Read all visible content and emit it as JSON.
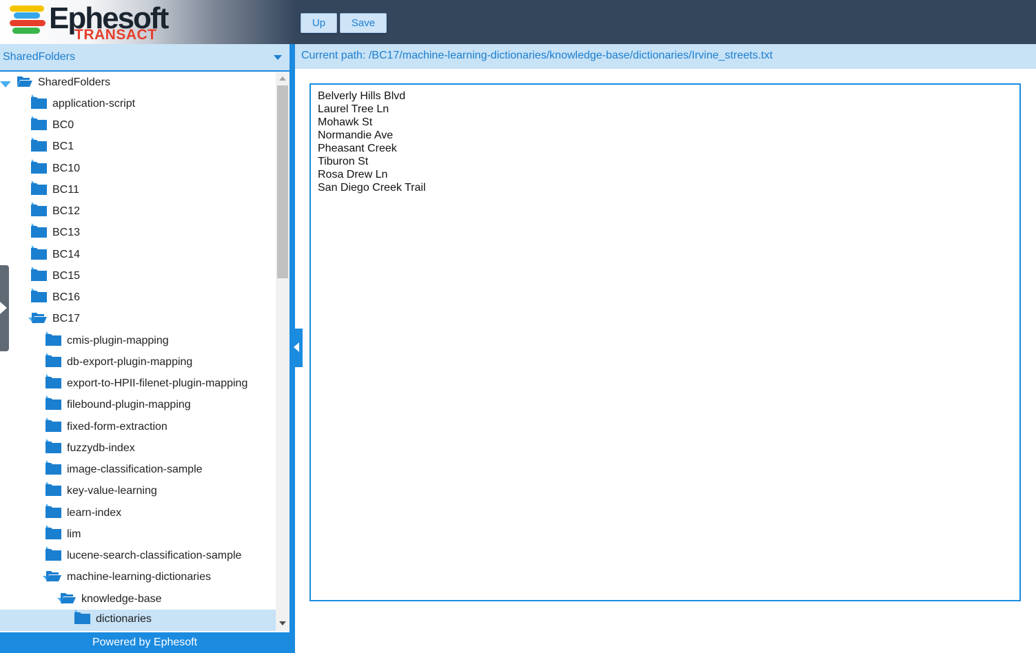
{
  "header": {
    "logo_text": "Ephesoft",
    "logo_subtext": "TRANSACT",
    "buttons": {
      "up_label": "Up",
      "save_label": "Save"
    },
    "colors": {
      "header_bg": "#34465c",
      "accent": "#1b8be0",
      "logo_red": "#e53f2c"
    }
  },
  "sidebar": {
    "dropdown_value": "SharedFolders",
    "footer": "Powered by Ephesoft",
    "tree": [
      {
        "label": "SharedFolders",
        "level": 0,
        "expanded": true,
        "selected": false
      },
      {
        "label": "application-script",
        "level": 1,
        "expanded": false,
        "selected": false
      },
      {
        "label": "BC0",
        "level": 1,
        "expanded": false,
        "selected": false
      },
      {
        "label": "BC1",
        "level": 1,
        "expanded": false,
        "selected": false
      },
      {
        "label": "BC10",
        "level": 1,
        "expanded": false,
        "selected": false
      },
      {
        "label": "BC11",
        "level": 1,
        "expanded": false,
        "selected": false
      },
      {
        "label": "BC12",
        "level": 1,
        "expanded": false,
        "selected": false
      },
      {
        "label": "BC13",
        "level": 1,
        "expanded": false,
        "selected": false
      },
      {
        "label": "BC14",
        "level": 1,
        "expanded": false,
        "selected": false
      },
      {
        "label": "BC15",
        "level": 1,
        "expanded": false,
        "selected": false
      },
      {
        "label": "BC16",
        "level": 1,
        "expanded": false,
        "selected": false
      },
      {
        "label": "BC17",
        "level": 1,
        "expanded": true,
        "selected": false
      },
      {
        "label": "cmis-plugin-mapping",
        "level": 2,
        "expanded": false,
        "selected": false
      },
      {
        "label": "db-export-plugin-mapping",
        "level": 2,
        "expanded": false,
        "selected": false
      },
      {
        "label": "export-to-HPII-filenet-plugin-mapping",
        "level": 2,
        "expanded": false,
        "selected": false
      },
      {
        "label": "filebound-plugin-mapping",
        "level": 2,
        "expanded": false,
        "selected": false
      },
      {
        "label": "fixed-form-extraction",
        "level": 2,
        "expanded": false,
        "selected": false
      },
      {
        "label": "fuzzydb-index",
        "level": 2,
        "expanded": false,
        "selected": false
      },
      {
        "label": "image-classification-sample",
        "level": 2,
        "expanded": false,
        "selected": false
      },
      {
        "label": "key-value-learning",
        "level": 2,
        "expanded": false,
        "selected": false
      },
      {
        "label": "learn-index",
        "level": 2,
        "expanded": false,
        "selected": false
      },
      {
        "label": "lim",
        "level": 2,
        "expanded": false,
        "selected": false
      },
      {
        "label": "lucene-search-classification-sample",
        "level": 2,
        "expanded": false,
        "selected": false
      },
      {
        "label": "machine-learning-dictionaries",
        "level": 2,
        "expanded": true,
        "selected": false
      },
      {
        "label": "knowledge-base",
        "level": 3,
        "expanded": true,
        "selected": false
      },
      {
        "label": "dictionaries",
        "level": 4,
        "expanded": false,
        "selected": true
      }
    ]
  },
  "main": {
    "current_path": "Current path: /BC17/machine-learning-dictionaries/knowledge-base/dictionaries/Irvine_streets.txt",
    "file_lines": [
      "Belverly Hills Blvd",
      "Laurel Tree Ln",
      "Mohawk St",
      "Normandie Ave",
      "Pheasant Creek",
      "Tiburon St",
      "Rosa Drew Ln",
      "San Diego Creek Trail"
    ]
  }
}
